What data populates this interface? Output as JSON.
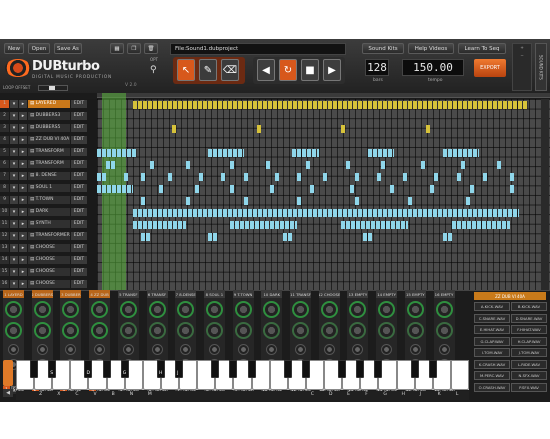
{
  "toolbar": {
    "new": "New",
    "open": "Open",
    "save_as": "Save As",
    "filename": "File:Sound1.dubproject",
    "sound_kits": "Sound Kits",
    "help_videos": "Help Videos",
    "learn": "Learn To Seq",
    "side_tab": "SOUND KITS"
  },
  "logo": {
    "name": "DUBturbo",
    "tagline": "DIGITAL MUSIC PRODUCTION",
    "version": "V 2.0",
    "opt": "OPT"
  },
  "transport": {
    "bars": "128",
    "bars_label": "bars",
    "tempo": "150.00",
    "tempo_label": "tempo",
    "export": "EXPORT"
  },
  "timeline": {
    "loop_offset": "LOOP OFFSET"
  },
  "tracks": [
    {
      "num": "1",
      "name": "LAYERED",
      "edit": "EDIT",
      "active": true
    },
    {
      "num": "2",
      "name": "DUBBERS3",
      "edit": "EDIT"
    },
    {
      "num": "3",
      "name": "DUBBERS5",
      "edit": "EDIT"
    },
    {
      "num": "4",
      "name": "ZZ DUB VI 40A",
      "edit": "EDIT"
    },
    {
      "num": "5",
      "name": "TRANSFORM",
      "edit": "EDIT"
    },
    {
      "num": "6",
      "name": "TRANSFORM",
      "edit": "EDIT"
    },
    {
      "num": "7",
      "name": "8. DENSE",
      "edit": "EDIT"
    },
    {
      "num": "8",
      "name": "SOUL 1",
      "edit": "EDIT"
    },
    {
      "num": "9",
      "name": "T.TOWN",
      "edit": "EDIT"
    },
    {
      "num": "10",
      "name": "DARK",
      "edit": "EDIT"
    },
    {
      "num": "11",
      "name": "SYNTH",
      "edit": "EDIT"
    },
    {
      "num": "12",
      "name": "TRANSFORMER",
      "edit": "EDIT"
    },
    {
      "num": "13",
      "name": "CHOOSE",
      "edit": "EDIT"
    },
    {
      "num": "14",
      "name": "CHOOSE",
      "edit": "EDIT"
    },
    {
      "num": "15",
      "name": "CHOOSE",
      "edit": "EDIT"
    },
    {
      "num": "16",
      "name": "CHOOSE",
      "edit": "EDIT"
    }
  ],
  "mixer": [
    {
      "num": "1",
      "label": "LAYERD",
      "active": true
    },
    {
      "num": "2",
      "label": "DUBBERS",
      "active": true
    },
    {
      "num": "3",
      "label": "DUBBER",
      "active": true
    },
    {
      "num": "4",
      "label": "ZZ DUB",
      "active": true
    },
    {
      "num": "5",
      "label": "TRANSF"
    },
    {
      "num": "6",
      "label": "TRANSF"
    },
    {
      "num": "7",
      "label": "8.DENSE"
    },
    {
      "num": "8",
      "label": "SOUL 1"
    },
    {
      "num": "9",
      "label": "T.TOWN"
    },
    {
      "num": "10",
      "label": "DARK"
    },
    {
      "num": "11",
      "label": "TRANSF"
    },
    {
      "num": "12",
      "label": "CHOOSE"
    },
    {
      "num": "13",
      "label": "EMPTY"
    },
    {
      "num": "14",
      "label": "EMPTY"
    },
    {
      "num": "15",
      "label": "EMPTY"
    },
    {
      "num": "16",
      "label": "EMPTY"
    }
  ],
  "mixer_buttons": {
    "solo": "S",
    "mute": "M"
  },
  "kit": {
    "name": "ZZ DUB VI 40A",
    "pads": [
      "A.KICK.WAV",
      "B.KICK.WAV",
      "C.SNARE.WAV",
      "D.SNARE.WAV",
      "E.HIHAT.WAV",
      "F.HIHAT.WAV",
      "G.CLAP.WAV",
      "H.CLAP.WAV",
      "I.TOM.WAV",
      "J.TOM.WAV",
      "K.CRASH.WAV",
      "L.RIDE.WAV",
      "M.PERC.WAV",
      "N.SFX.WAV",
      "O.CRASH.WAV",
      "P.SFX.WAV"
    ]
  },
  "keyboard": {
    "white_labels": [
      "",
      "Z",
      "X",
      "C",
      "V",
      "B",
      "N",
      "M",
      "",
      "",
      "",
      "",
      "",
      "",
      "",
      "",
      "C",
      "D",
      "E",
      "F",
      "G",
      "H",
      "J",
      "K",
      "L"
    ],
    "black_labels": [
      "",
      "S",
      "D",
      "",
      "G",
      "H",
      "J",
      "",
      "",
      "",
      "",
      "",
      "",
      "",
      "",
      "",
      "",
      "",
      "",
      "",
      ""
    ],
    "side_label": "KEYS"
  },
  "colors": {
    "accent": "#e06a1f",
    "loop": "#5ab43c",
    "note_yellow": "#d6c23a",
    "note_blue": "#8fd6ea"
  },
  "note_rows": [
    {
      "row": 0,
      "color": "yellow",
      "blocks": [
        [
          0.08,
          0.97
        ]
      ]
    },
    {
      "row": 2,
      "color": "yellow",
      "blocks": [
        [
          0.17,
          0.18
        ],
        [
          0.36,
          0.37
        ],
        [
          0.55,
          0.56
        ],
        [
          0.74,
          0.75
        ]
      ]
    },
    {
      "row": 4,
      "color": "blue",
      "blocks": [
        [
          0.0,
          0.09
        ],
        [
          0.25,
          0.33
        ],
        [
          0.44,
          0.5
        ],
        [
          0.61,
          0.67
        ],
        [
          0.78,
          0.86
        ]
      ]
    },
    {
      "row": 5,
      "color": "blue",
      "blocks": [
        [
          0.02,
          0.04
        ],
        [
          0.12,
          0.13
        ],
        [
          0.2,
          0.21
        ],
        [
          0.3,
          0.31
        ],
        [
          0.38,
          0.39
        ],
        [
          0.47,
          0.48
        ],
        [
          0.56,
          0.57
        ],
        [
          0.64,
          0.65
        ],
        [
          0.73,
          0.74
        ],
        [
          0.82,
          0.83
        ],
        [
          0.9,
          0.91
        ]
      ]
    },
    {
      "row": 6,
      "color": "blue",
      "blocks": [
        [
          0.0,
          0.02
        ],
        [
          0.06,
          0.07
        ],
        [
          0.1,
          0.11
        ],
        [
          0.16,
          0.17
        ],
        [
          0.23,
          0.24
        ],
        [
          0.28,
          0.29
        ],
        [
          0.33,
          0.34
        ],
        [
          0.4,
          0.41
        ],
        [
          0.45,
          0.46
        ],
        [
          0.51,
          0.52
        ],
        [
          0.58,
          0.59
        ],
        [
          0.63,
          0.64
        ],
        [
          0.69,
          0.7
        ],
        [
          0.76,
          0.77
        ],
        [
          0.81,
          0.82
        ],
        [
          0.87,
          0.88
        ],
        [
          0.93,
          0.94
        ]
      ]
    },
    {
      "row": 7,
      "color": "blue",
      "blocks": [
        [
          0.0,
          0.08
        ],
        [
          0.14,
          0.15
        ],
        [
          0.22,
          0.23
        ],
        [
          0.3,
          0.31
        ],
        [
          0.39,
          0.4
        ],
        [
          0.48,
          0.49
        ],
        [
          0.57,
          0.58
        ],
        [
          0.66,
          0.67
        ],
        [
          0.75,
          0.76
        ],
        [
          0.84,
          0.85
        ],
        [
          0.93,
          0.94
        ]
      ]
    },
    {
      "row": 8,
      "color": "blue",
      "blocks": [
        [
          0.1,
          0.11
        ],
        [
          0.2,
          0.21
        ],
        [
          0.33,
          0.34
        ],
        [
          0.45,
          0.46
        ],
        [
          0.58,
          0.59
        ],
        [
          0.7,
          0.71
        ],
        [
          0.83,
          0.84
        ]
      ]
    },
    {
      "row": 9,
      "color": "blue",
      "blocks": [
        [
          0.08,
          0.95
        ]
      ]
    },
    {
      "row": 10,
      "color": "blue",
      "blocks": [
        [
          0.08,
          0.2
        ],
        [
          0.3,
          0.45
        ],
        [
          0.55,
          0.7
        ],
        [
          0.8,
          0.93
        ]
      ]
    },
    {
      "row": 11,
      "color": "blue",
      "blocks": [
        [
          0.1,
          0.12
        ],
        [
          0.25,
          0.27
        ],
        [
          0.42,
          0.44
        ],
        [
          0.6,
          0.62
        ],
        [
          0.78,
          0.8
        ]
      ]
    }
  ]
}
